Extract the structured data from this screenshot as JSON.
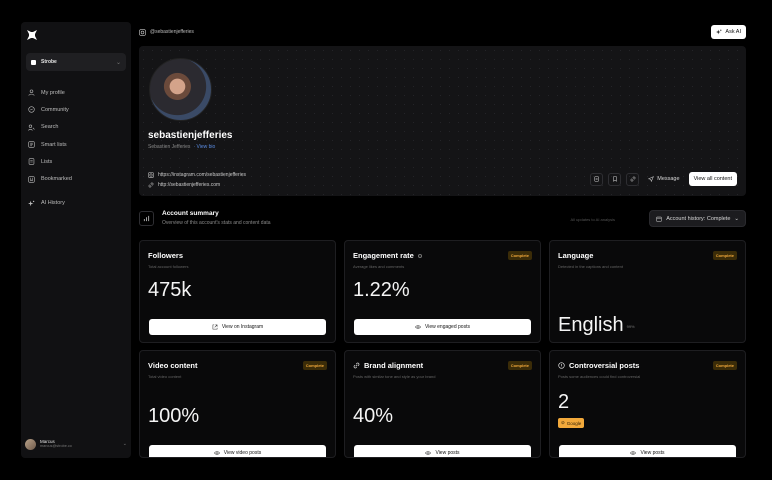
{
  "sidebar": {
    "workspace": "Strobe",
    "items": [
      {
        "label": "My profile",
        "icon": "user-icon"
      },
      {
        "label": "Community",
        "icon": "community-icon"
      },
      {
        "label": "Search",
        "icon": "search-icon"
      },
      {
        "label": "Smart lists",
        "icon": "smart-list-icon"
      },
      {
        "label": "Lists",
        "icon": "list-icon"
      },
      {
        "label": "Bookmarked",
        "icon": "bookmark-icon"
      }
    ],
    "ai_history": "AI History",
    "user": {
      "name": "Marcus",
      "email": "marcus@strobe.co"
    }
  },
  "topbar": {
    "handle": "@sebastienjefferies",
    "ask_ai": "Ask AI"
  },
  "profile": {
    "username": "sebastienjefferies",
    "display_name": "Sebastien Jefferies",
    "view_bio": "View bio",
    "instagram_url": "https://instagram.com/sebastienjefferies",
    "website_url": "http://sebastienjefferies.com",
    "message": "Message",
    "view_all": "View all content"
  },
  "summary": {
    "title": "Account summary",
    "subtitle": "Overview of this account's stats and content data",
    "note": "All updates to AI analysis",
    "history_label": "Account history: Complete"
  },
  "cards": [
    {
      "title": "Followers",
      "subtitle": "Total account followers",
      "value": "475k",
      "button": "View on Instagram",
      "badge": ""
    },
    {
      "title": "Engagement rate",
      "subtitle": "Average likes and comments",
      "value": "1.22%",
      "button": "View engaged posts",
      "badge": "Complete"
    },
    {
      "title": "Language",
      "subtitle": "Detected in the captions and content",
      "value": "English",
      "suffix": "99%",
      "badge": "Complete"
    },
    {
      "title": "Video content",
      "subtitle": "Total video content",
      "value": "100%",
      "button": "View video posts",
      "badge": "Complete"
    },
    {
      "title": "Brand alignment",
      "subtitle": "Posts with similar tone and style as your brand",
      "value": "40%",
      "button": "View posts",
      "badge": "Complete"
    },
    {
      "title": "Controversial posts",
      "subtitle": "Posts some audiences could find controversial",
      "value": "2",
      "tag": "Google",
      "button": "View posts",
      "badge": "Complete"
    }
  ],
  "colors": {
    "background": "#000000",
    "panel": "#111113",
    "accent": "#f2a93b",
    "link": "#5a8be0"
  }
}
